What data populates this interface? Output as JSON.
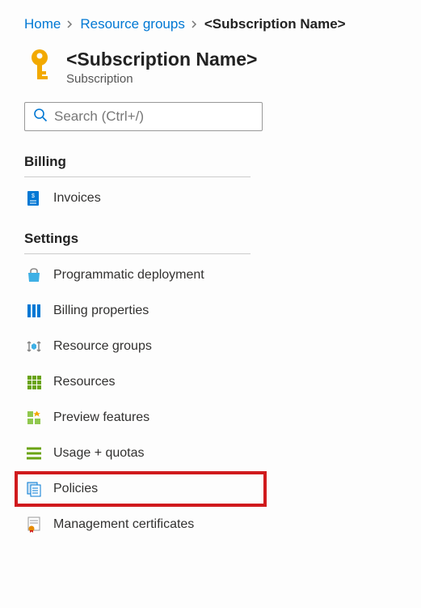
{
  "breadcrumb": {
    "home": "Home",
    "group": "Resource groups",
    "current": "<Subscription Name>"
  },
  "header": {
    "title": "<Subscription Name>",
    "subtitle": "Subscription"
  },
  "search": {
    "placeholder": "Search (Ctrl+/)"
  },
  "sections": {
    "billing": {
      "title": "Billing",
      "items": [
        {
          "label": "Invoices"
        }
      ]
    },
    "settings": {
      "title": "Settings",
      "items": [
        {
          "label": "Programmatic deployment"
        },
        {
          "label": "Billing properties"
        },
        {
          "label": "Resource groups"
        },
        {
          "label": "Resources"
        },
        {
          "label": "Preview features"
        },
        {
          "label": "Usage + quotas"
        },
        {
          "label": "Policies"
        },
        {
          "label": "Management certificates"
        }
      ]
    }
  }
}
